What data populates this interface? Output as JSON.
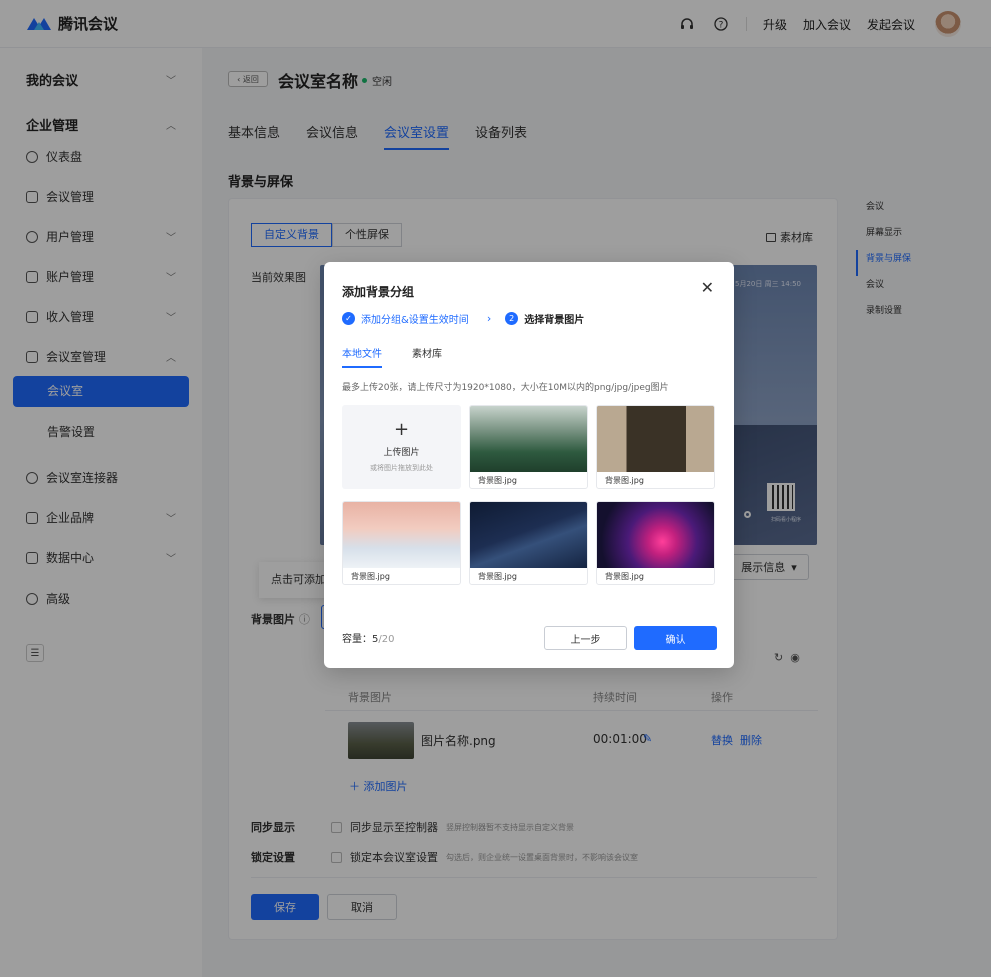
{
  "header": {
    "brand": "腾讯会议",
    "links": [
      "升级",
      "加入会议",
      "发起会议"
    ]
  },
  "sidebar": {
    "my_meetings": "我的会议",
    "enterprise": "企业管理",
    "items": [
      {
        "label": "仪表盘",
        "icon": "dashboard-icon"
      },
      {
        "label": "会议管理",
        "icon": "list-icon"
      },
      {
        "label": "用户管理",
        "icon": "user-icon"
      },
      {
        "label": "账户管理",
        "icon": "account-icon"
      },
      {
        "label": "收入管理",
        "icon": "income-icon"
      },
      {
        "label": "会议室管理",
        "icon": "room-icon"
      }
    ],
    "room_sub": [
      "会议室",
      "告警设置"
    ],
    "items2": [
      {
        "label": "会议室连接器",
        "icon": "link-icon"
      },
      {
        "label": "企业品牌",
        "icon": "brand-icon"
      },
      {
        "label": "数据中心",
        "icon": "data-icon"
      },
      {
        "label": "高级",
        "icon": "advanced-icon"
      }
    ]
  },
  "main": {
    "back": "返回",
    "room_name": "会议室名称",
    "status": "空闲",
    "tabs": [
      "基本信息",
      "会议信息",
      "会议室设置",
      "设备列表"
    ],
    "section": "背景与屏保",
    "seg": [
      "自定义背景",
      "个性屏保"
    ],
    "library": "素材库",
    "current_preview": "当前效果图",
    "preview_date": "5月20日 周三 14:50",
    "preview_qr_caption": "扫码看小程序",
    "show_info": "展示信息",
    "tip": "点击可添加",
    "bg_image_label": "背景图片",
    "table_head": {
      "image": "背景图片",
      "duration": "持续时间",
      "ops": "操作"
    },
    "row": {
      "name": "图片名称.png",
      "duration": "00:01:00",
      "replace": "替换",
      "delete": "删除"
    },
    "add_image": "添加图片",
    "sync_label": "同步显示",
    "sync_text": "同步显示至控制器",
    "sync_hint": "竖屏控制器暂不支持显示自定义背景",
    "lock_label": "锁定设置",
    "lock_text": "锁定本会议室设置",
    "lock_hint": "勾选后，则企业统一设置桌面背景时，不影响该会议室",
    "save": "保存",
    "cancel": "取消"
  },
  "anchor": [
    "会议",
    "屏幕显示",
    "背景与屏保",
    "会议",
    "录制设置"
  ],
  "modal": {
    "title": "添加背景分组",
    "step1": "添加分组&设置生效时间",
    "step2_num": "2",
    "step2": "选择背景图片",
    "tabs": [
      "本地文件",
      "素材库"
    ],
    "tip": "最多上传20张，请上传尺寸为1920*1080，大小在10M以内的png/jpg/jpeg图片",
    "upload_plus": "+",
    "upload_title": "上传图片",
    "upload_hint": "或将图片拖放到此处",
    "images": [
      {
        "caption": "背景图.jpg"
      },
      {
        "caption": "背景图.jpg"
      },
      {
        "caption": "背景图.jpg"
      },
      {
        "caption": "背景图.jpg"
      },
      {
        "caption": "背景图.jpg"
      }
    ],
    "capacity_label": "容量：",
    "capacity_used": "5",
    "capacity_total": "/20",
    "prev": "上一步",
    "confirm": "确认"
  }
}
